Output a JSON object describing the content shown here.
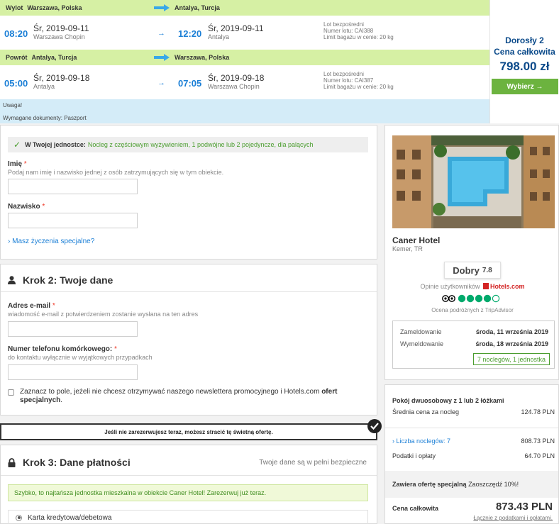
{
  "flight": {
    "outbound": {
      "label": "Wylot",
      "from": "Warszawa, Polska",
      "to": "Antalya, Turcja",
      "dep_time": "08:20",
      "dep_date": "Śr, 2019-09-11",
      "dep_airport": "Warszawa Chopin",
      "arr_time": "12:20",
      "arr_date": "Śr, 2019-09-11",
      "arr_airport": "Antalya",
      "info_direct": "Lot bezpośredni",
      "info_flight": "Numer lotu: CAI388",
      "info_baggage": "Limit bagażu w cenie: 20 kg"
    },
    "inbound": {
      "label": "Powrót",
      "from": "Antalya, Turcja",
      "to": "Warszawa, Polska",
      "dep_time": "05:00",
      "dep_date": "Śr, 2019-09-18",
      "dep_airport": "Antalya",
      "arr_time": "07:05",
      "arr_date": "Śr, 2019-09-18",
      "arr_airport": "Warszawa Chopin",
      "info_direct": "Lot bezpośredni",
      "info_flight": "Numer lotu: CAI387",
      "info_baggage": "Limit bagażu w cenie: 20 kg"
    },
    "notice_title": "Uwaga!",
    "notice_docs": "Wymagane dokumenty: Paszport",
    "price": {
      "adults": "Dorosły 2",
      "total_label": "Cena całkowita",
      "amount": "798.00 zł",
      "select_label": "Wybierz →"
    }
  },
  "unit": {
    "title": "W Twojej jednostce:",
    "desc": "Nocleg z częściowym wyżywieniem, 1 podwójne lub 2 pojedyncze, dla palących"
  },
  "guest": {
    "first_name_label": "Imię",
    "first_name_help": "Podaj nam imię i nazwisko jednej z osób zatrzymujących się w tym obiekcie.",
    "last_name_label": "Nazwisko",
    "special_requests": "Masz życzenia specjalne?"
  },
  "step2": {
    "title": "Krok 2: Twoje dane",
    "email_label": "Adres e-mail",
    "email_help": "wiadomość e-mail z potwierdzeniem zostanie wysłana na ten adres",
    "phone_label": "Numer telefonu komórkowego:",
    "phone_help": "do kontaktu wyłącznie w wyjątkowych przypadkach",
    "newsletter_prefix": "Zaznacz to pole, jeżeli nie chcesz otrzymywać naszego newslettera promocyjnego i Hotels.com ",
    "newsletter_bold": "ofert specjalnych",
    "newsletter_suffix": "."
  },
  "lose_offer": "Jeśli nie zarezerwujesz teraz, możesz stracić tę świetną ofertę.",
  "step3": {
    "title": "Krok 3: Dane płatności",
    "secure": "Twoje dane są w pełni bezpieczne",
    "promo": "Szybko, to najtańsza jednostka mieszkalna w obiekcie Caner Hotel! Zarezerwuj już teraz.",
    "card_option": "Karta kredytowa/debetowa"
  },
  "hotel": {
    "name": "Caner Hotel",
    "location": "Kemer, TR",
    "rating_word": "Dobry",
    "rating_score": "7.8",
    "reviews_prefix": "Opinie użytkowników",
    "reviews_brand": "Hotels.com",
    "ta_label": "Ocena podróżnych z TripAdvisor",
    "ta_bubbles": 4,
    "checkin_label": "Zameldowanie",
    "checkin_date": "środa, 11 września 2019",
    "checkout_label": "Wymeldowanie",
    "checkout_date": "środa, 18 września 2019",
    "nights_badge": "7 noclegów, 1 jednostka"
  },
  "summary": {
    "room": "Pokój dwuosobowy z 1 lub 2 łóżkami",
    "avg_label": "Średnia cena za nocleg",
    "avg_value": "124.78 PLN",
    "nights_label": "Liczba noclegów: 7",
    "nights_value": "808.73 PLN",
    "taxes_label": "Podatki i opłaty",
    "taxes_value": "64.70 PLN",
    "special_bold": "Zawiera ofertę specjalną",
    "special_text": "Zaoszczędź 10%!",
    "total_label": "Cena całkowita",
    "total_value": "873.43 PLN",
    "total_note": "Łącznie z podatkami i opłatami."
  },
  "colors": {
    "accent_blue": "#1b7fd6",
    "leg_header_green": "#d6f0a4",
    "button_green": "#6cb33f",
    "notice_blue": "#d4ecf8",
    "price_navy": "#0b4a8a",
    "tripadvisor_green": "#00aa6c"
  }
}
